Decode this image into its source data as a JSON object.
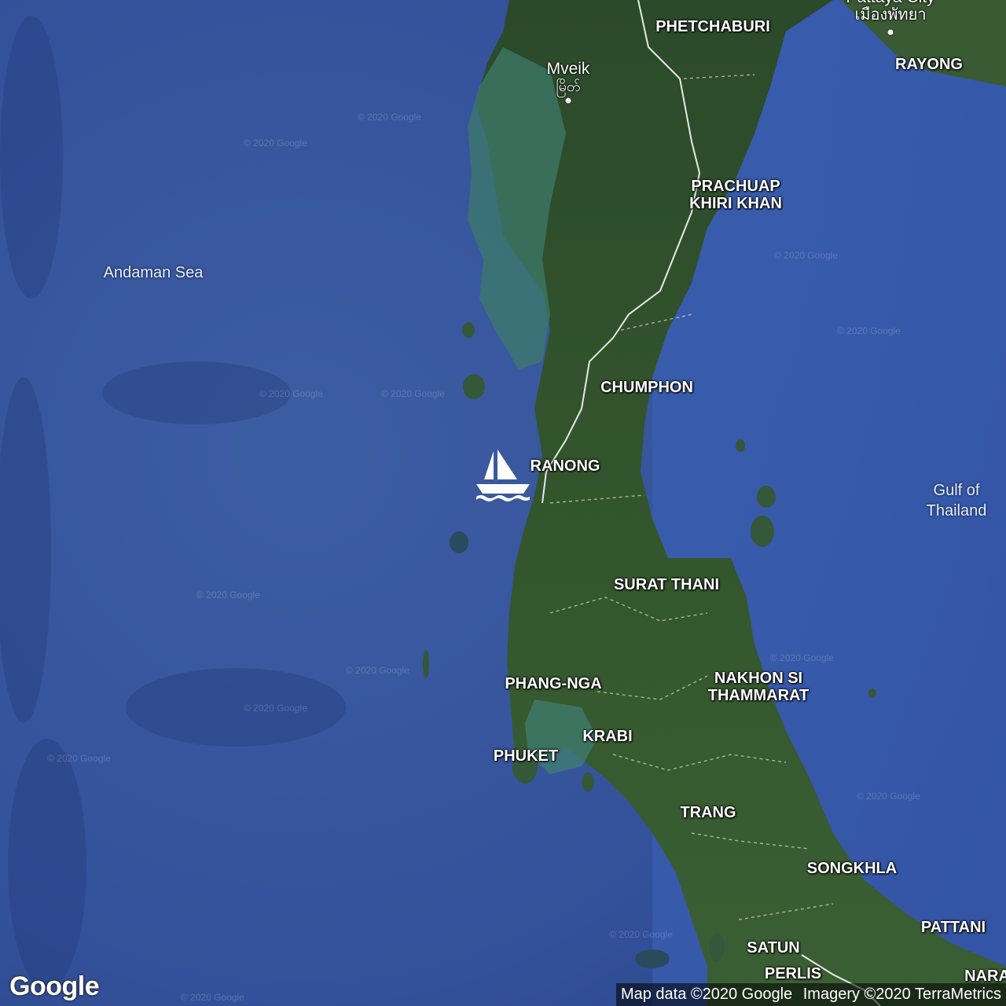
{
  "map": {
    "sea_labels": [
      {
        "id": "andaman-sea",
        "text": "Andaman Sea"
      },
      {
        "id": "gulf-of-thailand",
        "text": "Gulf of\nThailand"
      }
    ],
    "province_labels": [
      {
        "id": "phetchaburi",
        "text": "PHETCHABURI"
      },
      {
        "id": "rayong",
        "text": "RAYONG"
      },
      {
        "id": "prachuap",
        "text": "PRACHUAP\nKHIRI KHAN"
      },
      {
        "id": "chumphon",
        "text": "CHUMPHON"
      },
      {
        "id": "ranong",
        "text": "RANONG"
      },
      {
        "id": "surat-thani",
        "text": "SURAT THANI"
      },
      {
        "id": "phang-nga",
        "text": "PHANG-NGA"
      },
      {
        "id": "nakhon-si",
        "text": "NAKHON SI\nTHAMMARAT"
      },
      {
        "id": "krabi",
        "text": "KRABI"
      },
      {
        "id": "phuket",
        "text": "PHUKET"
      },
      {
        "id": "trang",
        "text": "TRANG"
      },
      {
        "id": "songkhla",
        "text": "SONGKHLA"
      },
      {
        "id": "pattani",
        "text": "PATTANI"
      },
      {
        "id": "satun",
        "text": "SATUN"
      },
      {
        "id": "perlis",
        "text": "PERLIS"
      },
      {
        "id": "narathiwat",
        "text": "NARA"
      }
    ],
    "city_labels": {
      "mveik": {
        "name": "Mveik",
        "local": "မြိတ်"
      },
      "pattaya": {
        "name": "Pattaya City",
        "local": "เมืองพัทยา"
      }
    },
    "marker_icon": "sailboat-icon",
    "watermark": "© 2020 Google"
  },
  "branding": {
    "logo": "Google"
  },
  "attribution": {
    "map_data": "Map data ©2020 Google",
    "imagery": "Imagery ©2020 TerraMetrics"
  }
}
